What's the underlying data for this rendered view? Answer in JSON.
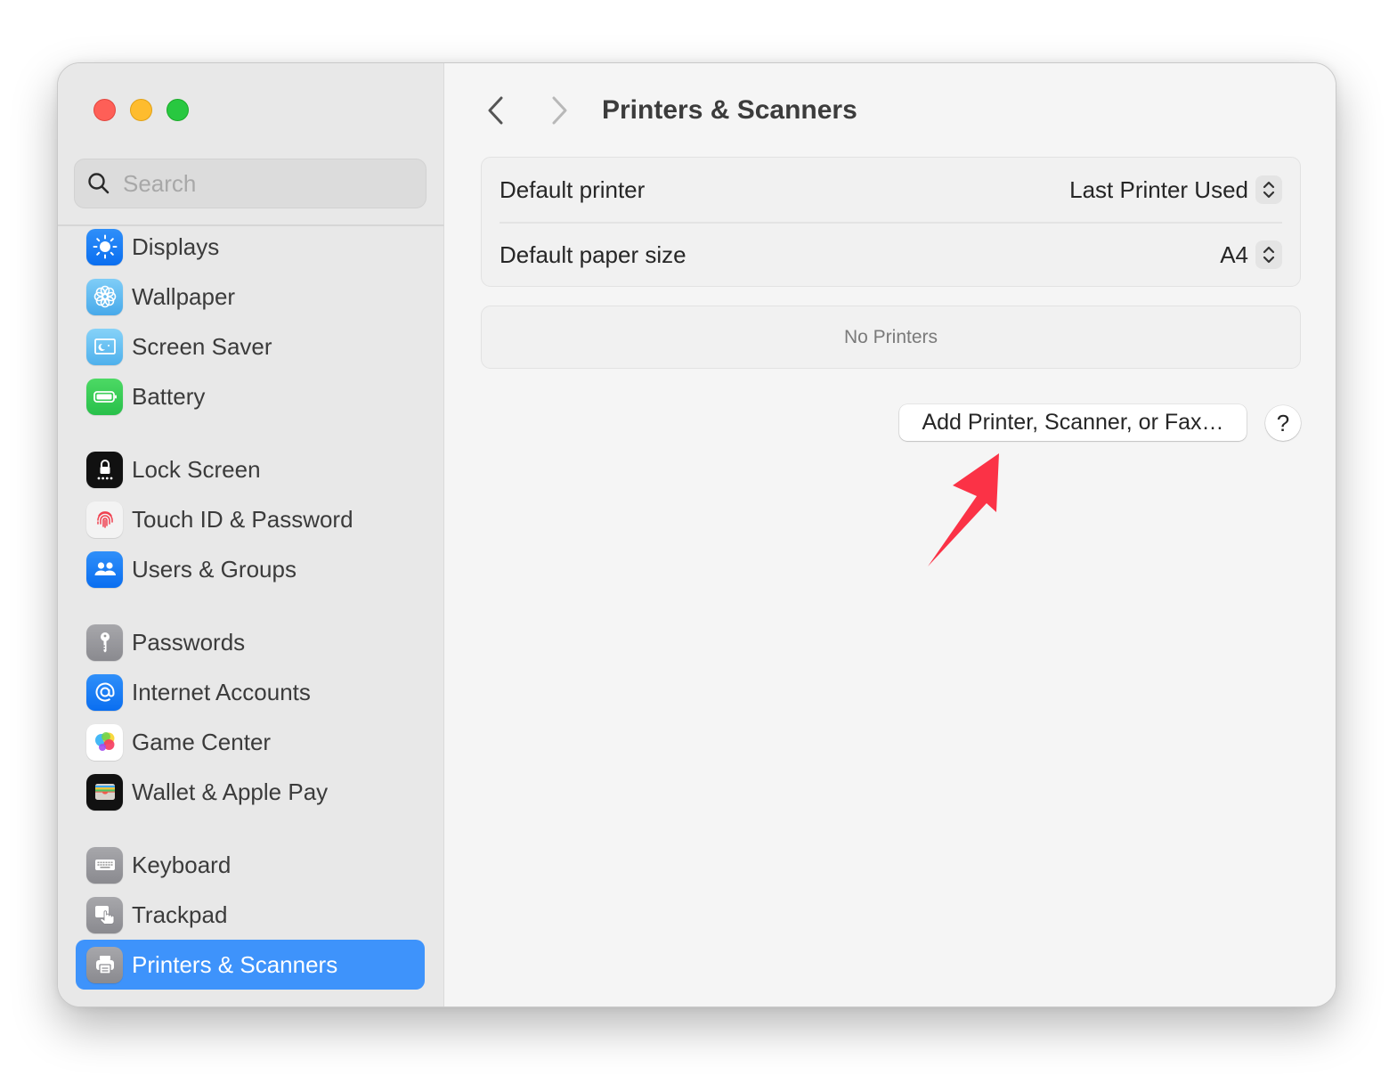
{
  "window": {
    "title": "Printers & Scanners",
    "traffic_lights": [
      "close",
      "minimize",
      "zoom"
    ]
  },
  "sidebar": {
    "search": {
      "placeholder": "Search",
      "value": "",
      "icon": "magnifying-glass-icon"
    },
    "items": [
      {
        "label": "Displays",
        "icon": "sun-icon",
        "color": "#1a7ff5",
        "active": false
      },
      {
        "label": "Wallpaper",
        "icon": "flower-icon",
        "color": "#5ab8f0",
        "active": false
      },
      {
        "label": "Screen Saver",
        "icon": "screen-moon-icon",
        "color": "#5fbef0",
        "active": false
      },
      {
        "label": "Battery",
        "icon": "battery-icon",
        "color": "#34c759",
        "active": false
      },
      {
        "label": "Lock Screen",
        "icon": "lock-icon",
        "color": "#1c1c1e",
        "active": false
      },
      {
        "label": "Touch ID & Password",
        "icon": "fingerprint-icon",
        "color": "#f2f2f2",
        "active": false
      },
      {
        "label": "Users & Groups",
        "icon": "users-icon",
        "color": "#1a7ff5",
        "active": false
      },
      {
        "label": "Passwords",
        "icon": "key-icon",
        "color": "#8e8e93",
        "active": false
      },
      {
        "label": "Internet Accounts",
        "icon": "at-icon",
        "color": "#1a7ff5",
        "active": false
      },
      {
        "label": "Game Center",
        "icon": "game-center-icon",
        "color": "#ffffff",
        "active": false
      },
      {
        "label": "Wallet & Apple Pay",
        "icon": "wallet-icon",
        "color": "#1c1c1e",
        "active": false
      },
      {
        "label": "Keyboard",
        "icon": "keyboard-icon",
        "color": "#8e8e93",
        "active": false
      },
      {
        "label": "Trackpad",
        "icon": "trackpad-icon",
        "color": "#8e8e93",
        "active": false
      },
      {
        "label": "Printers & Scanners",
        "icon": "printer-icon",
        "color": "#8e8e93",
        "active": true
      }
    ],
    "selection_color": "#3e93fb"
  },
  "main": {
    "title": "Printers & Scanners",
    "back_icon": "chevron-left-icon",
    "forward_icon": "chevron-right-icon",
    "settings": [
      {
        "label": "Default printer",
        "value": "Last Printer Used"
      },
      {
        "label": "Default paper size",
        "value": "A4"
      }
    ],
    "printers_list": {
      "empty_text": "No Printers"
    },
    "add_button_label": "Add Printer, Scanner, or Fax…",
    "help_label": "?",
    "annotation": {
      "type": "arrow",
      "color": "#fb3246",
      "points_to": "add-printer-button"
    }
  }
}
